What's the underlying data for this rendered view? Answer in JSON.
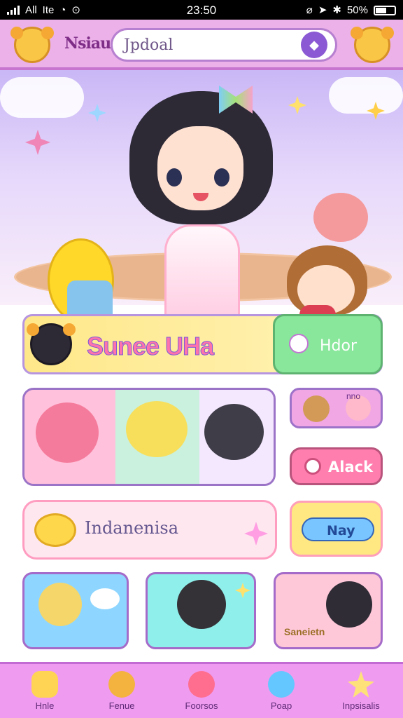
{
  "status_bar": {
    "carrier": "All",
    "network": "Ite",
    "time": "23:50",
    "battery": "50%"
  },
  "header": {
    "brand": "Nsiau",
    "search_value": "Jpdoal"
  },
  "featured": {
    "title": "Sunee UHa",
    "action_label": "Hdor"
  },
  "actions": {
    "side_top_label": "nno",
    "alert_label": "Alack",
    "play_label": "Nay"
  },
  "input": {
    "value": "Indanenisa"
  },
  "thumbs": [
    {
      "label": ""
    },
    {
      "label": ""
    },
    {
      "label": "Saneietn"
    }
  ],
  "bottom_nav": [
    {
      "label": "Hnle",
      "icon": "home-icon"
    },
    {
      "label": "Fenue",
      "icon": "bear-icon"
    },
    {
      "label": "Foorsos",
      "icon": "bubble-icon"
    },
    {
      "label": "Poap",
      "icon": "search-icon"
    },
    {
      "label": "Inpsisalis",
      "icon": "star-icon"
    }
  ],
  "colors": {
    "topbar": "#ebb1e8",
    "accent_pink": "#ff7eae",
    "accent_purple": "#9b74c7",
    "accent_green": "#88e79b",
    "accent_yellow": "#ffe781"
  }
}
